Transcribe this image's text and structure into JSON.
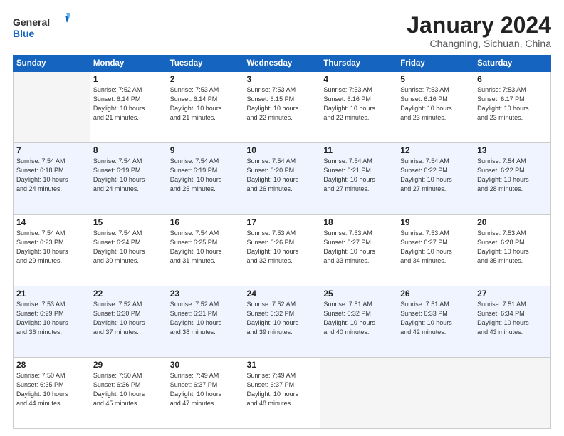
{
  "header": {
    "logo_general": "General",
    "logo_blue": "Blue",
    "month_title": "January 2024",
    "subtitle": "Changning, Sichuan, China"
  },
  "days_of_week": [
    "Sunday",
    "Monday",
    "Tuesday",
    "Wednesday",
    "Thursday",
    "Friday",
    "Saturday"
  ],
  "weeks": [
    [
      {
        "day": "",
        "info": ""
      },
      {
        "day": "1",
        "info": "Sunrise: 7:52 AM\nSunset: 6:14 PM\nDaylight: 10 hours\nand 21 minutes."
      },
      {
        "day": "2",
        "info": "Sunrise: 7:53 AM\nSunset: 6:14 PM\nDaylight: 10 hours\nand 21 minutes."
      },
      {
        "day": "3",
        "info": "Sunrise: 7:53 AM\nSunset: 6:15 PM\nDaylight: 10 hours\nand 22 minutes."
      },
      {
        "day": "4",
        "info": "Sunrise: 7:53 AM\nSunset: 6:16 PM\nDaylight: 10 hours\nand 22 minutes."
      },
      {
        "day": "5",
        "info": "Sunrise: 7:53 AM\nSunset: 6:16 PM\nDaylight: 10 hours\nand 23 minutes."
      },
      {
        "day": "6",
        "info": "Sunrise: 7:53 AM\nSunset: 6:17 PM\nDaylight: 10 hours\nand 23 minutes."
      }
    ],
    [
      {
        "day": "7",
        "info": "Sunrise: 7:54 AM\nSunset: 6:18 PM\nDaylight: 10 hours\nand 24 minutes."
      },
      {
        "day": "8",
        "info": "Sunrise: 7:54 AM\nSunset: 6:19 PM\nDaylight: 10 hours\nand 24 minutes."
      },
      {
        "day": "9",
        "info": "Sunrise: 7:54 AM\nSunset: 6:19 PM\nDaylight: 10 hours\nand 25 minutes."
      },
      {
        "day": "10",
        "info": "Sunrise: 7:54 AM\nSunset: 6:20 PM\nDaylight: 10 hours\nand 26 minutes."
      },
      {
        "day": "11",
        "info": "Sunrise: 7:54 AM\nSunset: 6:21 PM\nDaylight: 10 hours\nand 27 minutes."
      },
      {
        "day": "12",
        "info": "Sunrise: 7:54 AM\nSunset: 6:22 PM\nDaylight: 10 hours\nand 27 minutes."
      },
      {
        "day": "13",
        "info": "Sunrise: 7:54 AM\nSunset: 6:22 PM\nDaylight: 10 hours\nand 28 minutes."
      }
    ],
    [
      {
        "day": "14",
        "info": "Sunrise: 7:54 AM\nSunset: 6:23 PM\nDaylight: 10 hours\nand 29 minutes."
      },
      {
        "day": "15",
        "info": "Sunrise: 7:54 AM\nSunset: 6:24 PM\nDaylight: 10 hours\nand 30 minutes."
      },
      {
        "day": "16",
        "info": "Sunrise: 7:54 AM\nSunset: 6:25 PM\nDaylight: 10 hours\nand 31 minutes."
      },
      {
        "day": "17",
        "info": "Sunrise: 7:53 AM\nSunset: 6:26 PM\nDaylight: 10 hours\nand 32 minutes."
      },
      {
        "day": "18",
        "info": "Sunrise: 7:53 AM\nSunset: 6:27 PM\nDaylight: 10 hours\nand 33 minutes."
      },
      {
        "day": "19",
        "info": "Sunrise: 7:53 AM\nSunset: 6:27 PM\nDaylight: 10 hours\nand 34 minutes."
      },
      {
        "day": "20",
        "info": "Sunrise: 7:53 AM\nSunset: 6:28 PM\nDaylight: 10 hours\nand 35 minutes."
      }
    ],
    [
      {
        "day": "21",
        "info": "Sunrise: 7:53 AM\nSunset: 6:29 PM\nDaylight: 10 hours\nand 36 minutes."
      },
      {
        "day": "22",
        "info": "Sunrise: 7:52 AM\nSunset: 6:30 PM\nDaylight: 10 hours\nand 37 minutes."
      },
      {
        "day": "23",
        "info": "Sunrise: 7:52 AM\nSunset: 6:31 PM\nDaylight: 10 hours\nand 38 minutes."
      },
      {
        "day": "24",
        "info": "Sunrise: 7:52 AM\nSunset: 6:32 PM\nDaylight: 10 hours\nand 39 minutes."
      },
      {
        "day": "25",
        "info": "Sunrise: 7:51 AM\nSunset: 6:32 PM\nDaylight: 10 hours\nand 40 minutes."
      },
      {
        "day": "26",
        "info": "Sunrise: 7:51 AM\nSunset: 6:33 PM\nDaylight: 10 hours\nand 42 minutes."
      },
      {
        "day": "27",
        "info": "Sunrise: 7:51 AM\nSunset: 6:34 PM\nDaylight: 10 hours\nand 43 minutes."
      }
    ],
    [
      {
        "day": "28",
        "info": "Sunrise: 7:50 AM\nSunset: 6:35 PM\nDaylight: 10 hours\nand 44 minutes."
      },
      {
        "day": "29",
        "info": "Sunrise: 7:50 AM\nSunset: 6:36 PM\nDaylight: 10 hours\nand 45 minutes."
      },
      {
        "day": "30",
        "info": "Sunrise: 7:49 AM\nSunset: 6:37 PM\nDaylight: 10 hours\nand 47 minutes."
      },
      {
        "day": "31",
        "info": "Sunrise: 7:49 AM\nSunset: 6:37 PM\nDaylight: 10 hours\nand 48 minutes."
      },
      {
        "day": "",
        "info": ""
      },
      {
        "day": "",
        "info": ""
      },
      {
        "day": "",
        "info": ""
      }
    ]
  ]
}
